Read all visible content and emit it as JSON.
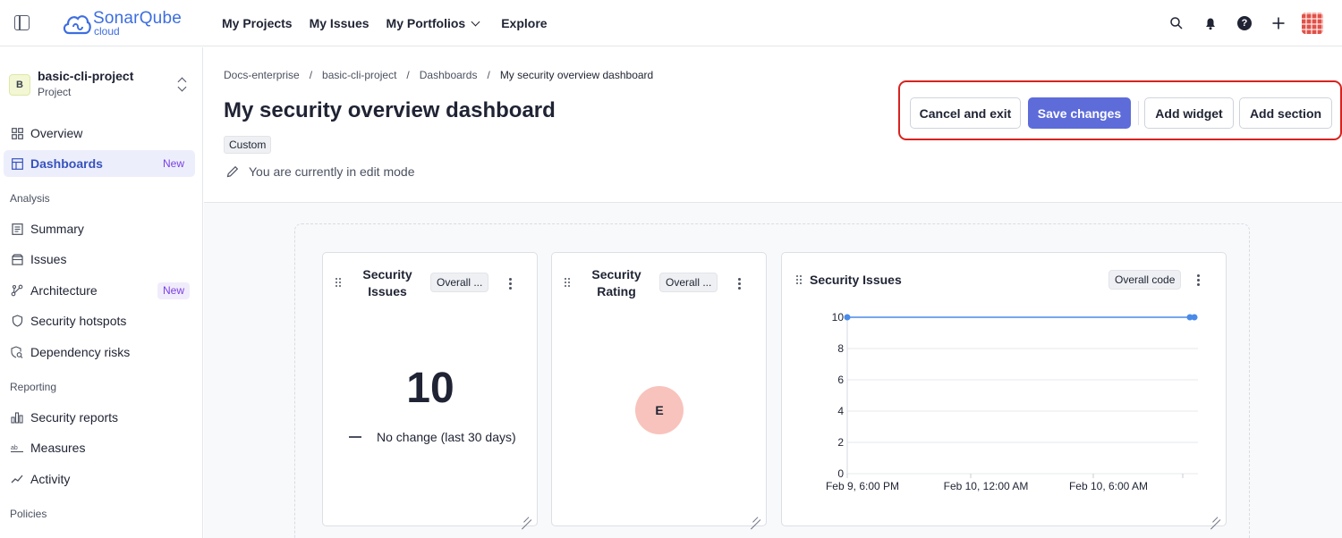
{
  "app": {
    "logo_name": "SonarQube",
    "logo_sub": "cloud"
  },
  "nav": {
    "items": [
      {
        "label": "My Projects"
      },
      {
        "label": "My Issues"
      },
      {
        "label": "My Portfolios"
      },
      {
        "label": "Explore"
      }
    ],
    "icons": [
      "search-icon",
      "bell-icon",
      "help-icon",
      "plus-icon",
      "avatar"
    ],
    "help_glyph": "?"
  },
  "sidebar": {
    "project_badge": "B",
    "project_name": "basic-cli-project",
    "project_type": "Project",
    "items": [
      {
        "label": "Overview",
        "icon": "overview-icon"
      },
      {
        "label": "Dashboards",
        "icon": "dashboard-icon",
        "badge": "New",
        "active": true
      },
      {
        "label": "Summary",
        "icon": "summary-icon"
      },
      {
        "label": "Issues",
        "icon": "issues-icon"
      },
      {
        "label": "Architecture",
        "icon": "architecture-icon",
        "badge": "New"
      },
      {
        "label": "Security hotspots",
        "icon": "shield-icon"
      },
      {
        "label": "Dependency risks",
        "icon": "dependency-icon"
      },
      {
        "label": "Security reports",
        "icon": "reports-icon"
      },
      {
        "label": "Measures",
        "icon": "measures-icon"
      },
      {
        "label": "Activity",
        "icon": "activity-icon"
      }
    ],
    "sections": {
      "analysis": "Analysis",
      "reporting": "Reporting",
      "policies": "Policies"
    }
  },
  "header": {
    "breadcrumb": [
      "Docs-enterprise",
      "basic-cli-project",
      "Dashboards",
      "My security overview dashboard"
    ],
    "breadcrumb_sep": "/",
    "title": "My security overview dashboard",
    "tag": "Custom",
    "edit_note": "You are currently in edit mode"
  },
  "actions": {
    "cancel": "Cancel and exit",
    "save": "Save changes",
    "add_widget": "Add widget",
    "add_section": "Add section"
  },
  "widgets": {
    "issues": {
      "title": "Security Issues",
      "scope": "Overall ...",
      "value": "10",
      "change": "No change (last 30 days)"
    },
    "rating": {
      "title": "Security Rating",
      "scope": "Overall ...",
      "grade": "E"
    },
    "trend": {
      "title": "Security Issues",
      "scope": "Overall code"
    }
  },
  "colors": {
    "accent": "#5d6cd9",
    "highlight_border": "#d7231f",
    "rating_e": "#f8c3bc",
    "line": "#4a8ae8",
    "new_badge": "#7b3fe4"
  },
  "chart_data": {
    "type": "line",
    "series": [
      {
        "x": [
          "Feb 9, 6:00 PM",
          "Feb 10, 9:40 AM",
          "Feb 10, 9:50 AM"
        ],
        "values": [
          10,
          10,
          10
        ]
      }
    ],
    "x_ticks": [
      "Feb 9, 6:00 PM",
      "Feb 10, 12:00 AM",
      "Feb 10, 6:00 AM"
    ],
    "y_ticks": [
      0,
      2,
      4,
      6,
      8,
      10
    ],
    "ylim": [
      0,
      10
    ],
    "grid": true
  }
}
